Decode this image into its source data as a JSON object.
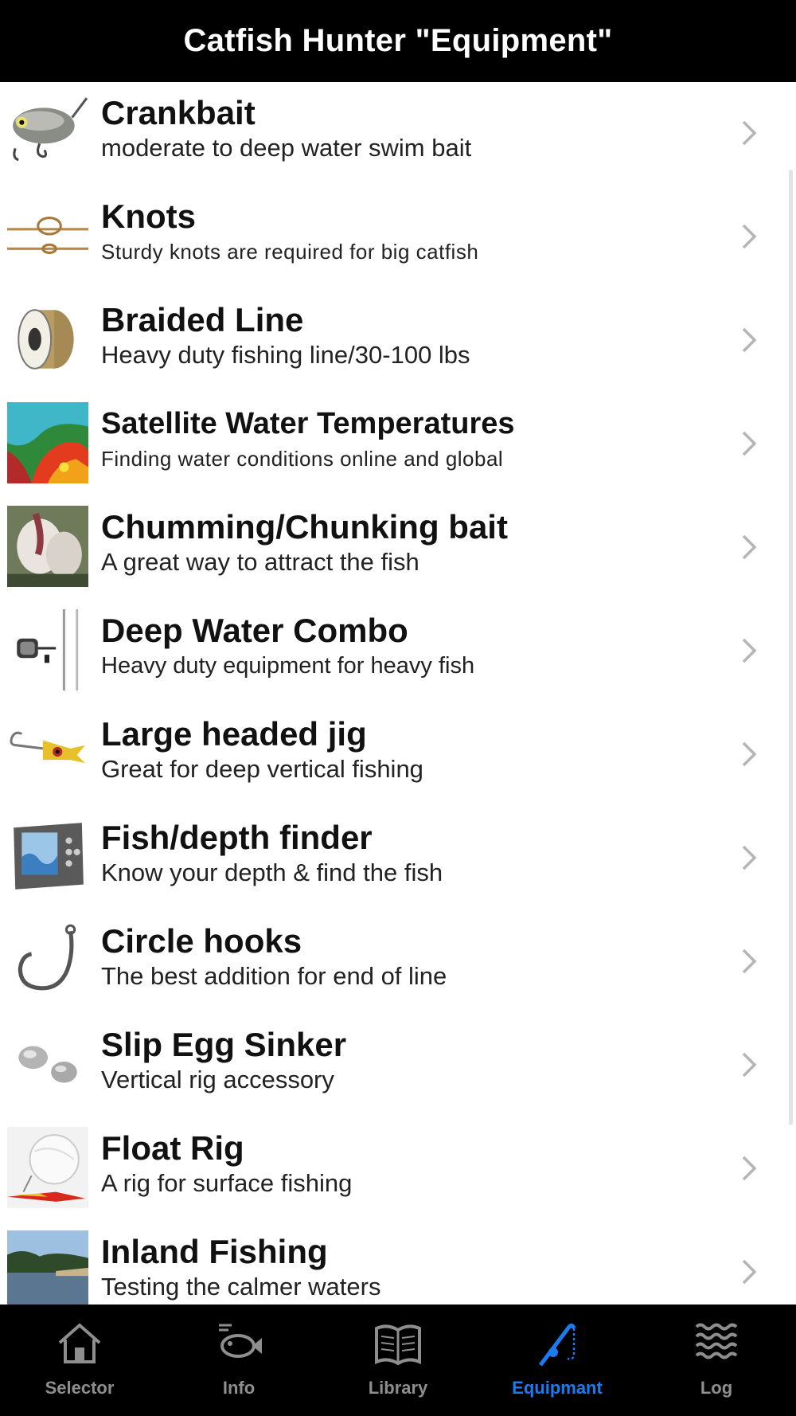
{
  "header": {
    "title": "Catfish Hunter \"Equipment\""
  },
  "items": [
    {
      "title": "Crankbait",
      "subtitle": "moderate to deep water swim bait",
      "icon": "crankbait-lure-icon"
    },
    {
      "title": "Knots",
      "subtitle": "Sturdy knots are required for big catfish",
      "icon": "knot-rope-icon"
    },
    {
      "title": "Braided Line",
      "subtitle": "Heavy duty fishing line/30-100 lbs",
      "icon": "line-spool-icon"
    },
    {
      "title": "Satellite Water Temperatures",
      "subtitle": "Finding water conditions online and global",
      "icon": "temperature-map-icon"
    },
    {
      "title": "Chumming/Chunking bait",
      "subtitle": "A great way to attract the fish",
      "icon": "bait-chunks-icon"
    },
    {
      "title": "Deep Water Combo",
      "subtitle": "Heavy duty equipment for heavy fish",
      "icon": "rod-reel-combo-icon"
    },
    {
      "title": "Large headed jig",
      "subtitle": "Great for deep vertical fishing",
      "icon": "jig-head-icon"
    },
    {
      "title": "Fish/depth finder",
      "subtitle": "Know your depth & find the fish",
      "icon": "depth-finder-icon"
    },
    {
      "title": "Circle hooks",
      "subtitle": "The best addition for end of line",
      "icon": "circle-hook-icon"
    },
    {
      "title": "Slip Egg Sinker",
      "subtitle": "Vertical rig accessory",
      "icon": "egg-sinker-icon"
    },
    {
      "title": "Float Rig",
      "subtitle": "A rig for surface fishing",
      "icon": "float-rig-icon"
    },
    {
      "title": "Inland Fishing",
      "subtitle": "Testing the calmer waters",
      "icon": "lake-photo-icon"
    }
  ],
  "tabs": [
    {
      "label": "Selector",
      "icon": "home-icon",
      "active": false
    },
    {
      "label": "Info",
      "icon": "fish-icon",
      "active": false
    },
    {
      "label": "Library",
      "icon": "book-icon",
      "active": false
    },
    {
      "label": "Equipmant",
      "icon": "fishing-rod-icon",
      "active": true
    },
    {
      "label": "Log",
      "icon": "waves-icon",
      "active": false
    }
  ],
  "colors": {
    "header_bg": "#000000",
    "tab_active": "#1a7cf0",
    "tab_inactive": "#8e8e8e"
  }
}
